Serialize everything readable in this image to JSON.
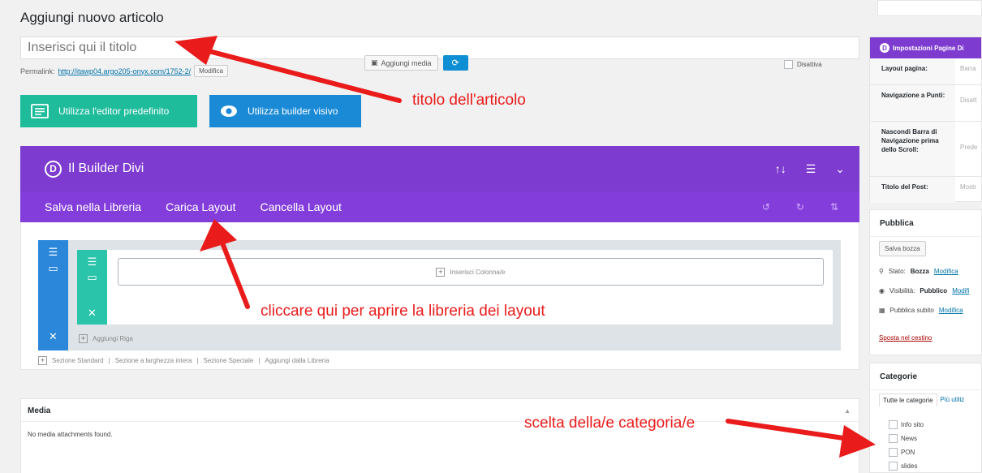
{
  "page_title": "Aggiungi nuovo articolo",
  "title_input": {
    "placeholder": "Inserisci qui il titolo"
  },
  "permalink": {
    "label": "Permalink:",
    "url": "http://itawp04.argo205-onyx.com/1752-2/",
    "edit_button": "Modifica"
  },
  "editor_buttons": {
    "default_editor": "Utilizza l'editor predefinito",
    "visual_builder": "Utilizza builder visivo"
  },
  "divi_builder": {
    "logo_letter": "D",
    "title": "Il Builder Divi",
    "menu": [
      "Salva nella Libreria",
      "Carica Layout",
      "Cancella Layout"
    ],
    "insert_columns": "Inserisci Colonna/e",
    "add_row": "Aggiungi Riga",
    "section_links": [
      "Sezione Standard",
      "Sezione a larghezza intera",
      "Sezione Speciale",
      "Aggiungi dalla Libreria"
    ]
  },
  "media": {
    "title": "Media",
    "empty_text": "No media attachments found.",
    "add_button": "Aggiungi media",
    "disable_label": "Disattiva"
  },
  "divi_settings": {
    "logo_letter": "D",
    "title": "Impostazioni Pagine Di",
    "rows": [
      {
        "key": "Layout pagina:",
        "value": "Barra"
      },
      {
        "key": "Navigazione a Punti:",
        "value": "Disatt"
      },
      {
        "key": "Nascondi Barra di Navigazione prima dello Scroll:",
        "value": "Prede"
      },
      {
        "key": "Titolo del Post:",
        "value": "Mostr"
      }
    ]
  },
  "publish": {
    "title": "Pubblica",
    "save_draft": "Salva bozza",
    "status_label": "Stato:",
    "status_value": "Bozza",
    "status_link": "Modifica",
    "visibility_label": "Visibilità:",
    "visibility_value": "Pubblico",
    "visibility_link": "Modifi",
    "schedule_value": "Pubblica subito",
    "schedule_link": "Modifica",
    "trash": "Sposta nel cestino"
  },
  "categories": {
    "title": "Categorie",
    "tab_all": "Tutte le categorie",
    "tab_popular": "Più utiliz",
    "items": [
      "Info sito",
      "News",
      "PON",
      "slides"
    ]
  },
  "annotations": {
    "title_note": "titolo dell'articolo",
    "layout_note": "cliccare qui per aprire la libreria dei layout",
    "category_note": "scelta della/e categoria/e"
  },
  "colors": {
    "divi_purple": "#7e3bd0",
    "teal": "#1fbc9c",
    "blue": "#1b8ad6",
    "annotation_red": "#ea1b1b"
  }
}
